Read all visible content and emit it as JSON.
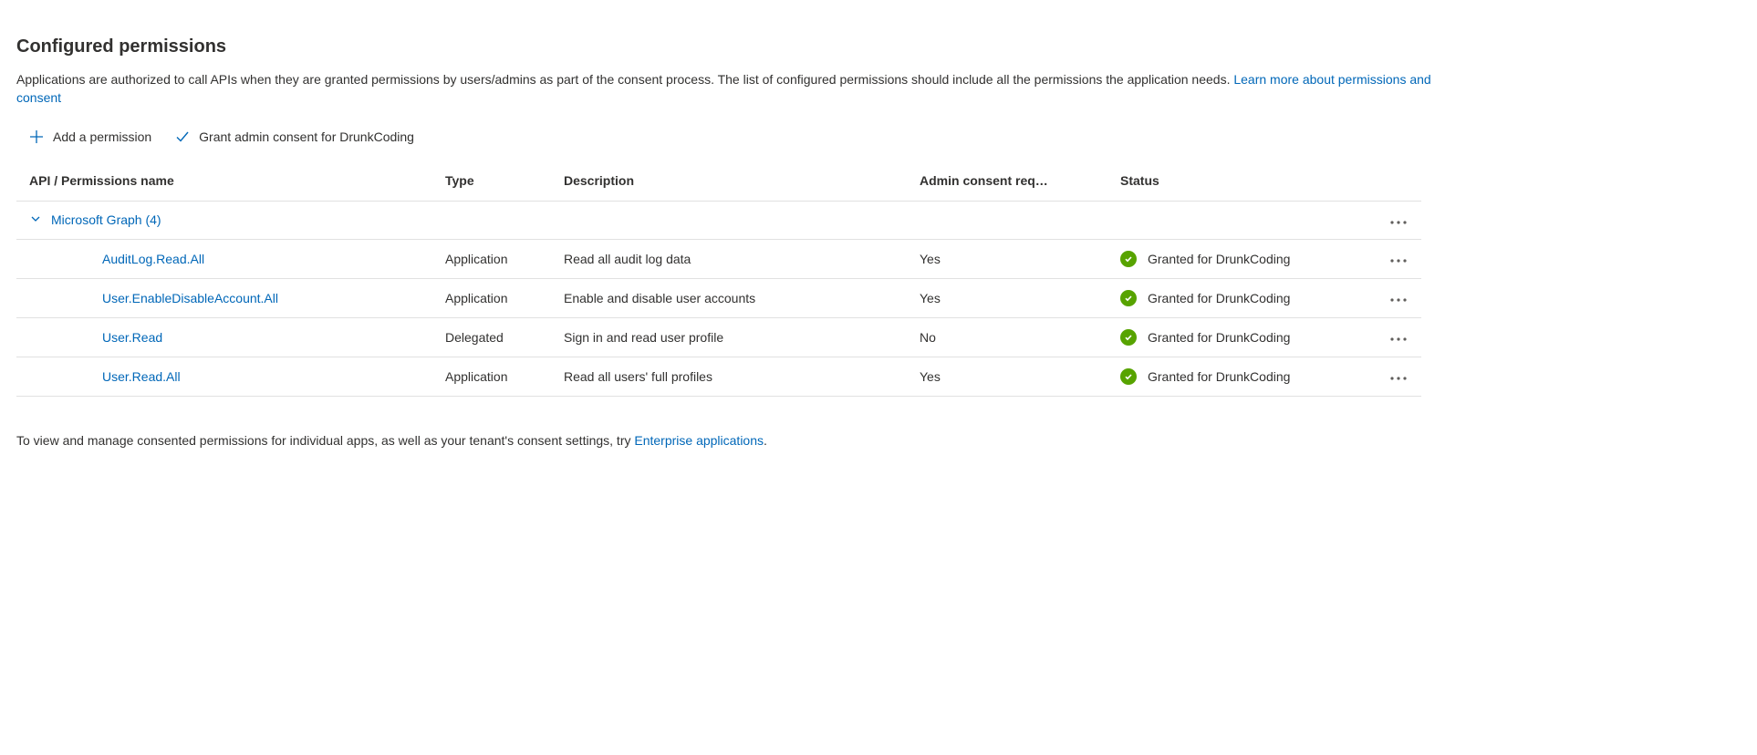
{
  "title": "Configured permissions",
  "description_prefix": "Applications are authorized to call APIs when they are granted permissions by users/admins as part of the consent process. The list of configured permissions should include all the permissions the application needs. ",
  "description_link": "Learn more about permissions and consent",
  "toolbar": {
    "add_permission": "Add a permission",
    "grant_consent": "Grant admin consent for DrunkCoding"
  },
  "columns": {
    "api": "API / Permissions name",
    "type": "Type",
    "description": "Description",
    "consent": "Admin consent req…",
    "status": "Status"
  },
  "api_group": "Microsoft Graph (4)",
  "rows": [
    {
      "name": "AuditLog.Read.All",
      "type": "Application",
      "description": "Read all audit log data",
      "consent": "Yes",
      "status": "Granted for DrunkCoding"
    },
    {
      "name": "User.EnableDisableAccount.All",
      "type": "Application",
      "description": "Enable and disable user accounts",
      "consent": "Yes",
      "status": "Granted for DrunkCoding"
    },
    {
      "name": "User.Read",
      "type": "Delegated",
      "description": "Sign in and read user profile",
      "consent": "No",
      "status": "Granted for DrunkCoding"
    },
    {
      "name": "User.Read.All",
      "type": "Application",
      "description": "Read all users' full profiles",
      "consent": "Yes",
      "status": "Granted for DrunkCoding"
    }
  ],
  "footer_prefix": "To view and manage consented permissions for individual apps, as well as your tenant's consent settings, try ",
  "footer_link": "Enterprise applications",
  "footer_suffix": "."
}
